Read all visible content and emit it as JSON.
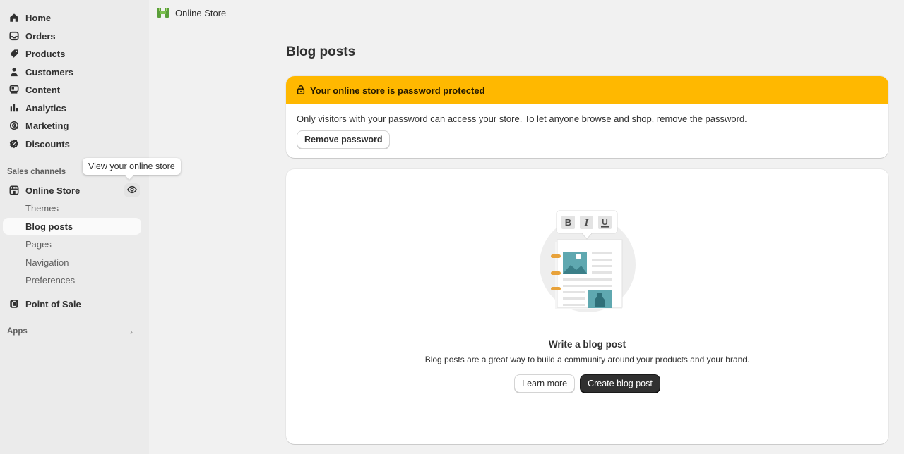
{
  "sidebar": {
    "items": [
      {
        "label": "Home",
        "icon": "home-icon"
      },
      {
        "label": "Orders",
        "icon": "inbox-icon"
      },
      {
        "label": "Products",
        "icon": "tag-icon"
      },
      {
        "label": "Customers",
        "icon": "person-icon"
      },
      {
        "label": "Content",
        "icon": "content-icon"
      },
      {
        "label": "Analytics",
        "icon": "bar-chart-icon"
      },
      {
        "label": "Marketing",
        "icon": "target-icon"
      },
      {
        "label": "Discounts",
        "icon": "discount-icon"
      }
    ],
    "sales_channels_label": "Sales channels",
    "online_store": {
      "label": "Online Store",
      "tooltip": "View your online store",
      "sub_items": [
        "Themes",
        "Blog posts",
        "Pages",
        "Navigation",
        "Preferences"
      ]
    },
    "point_of_sale": "Point of Sale",
    "apps_label": "Apps"
  },
  "topbar": {
    "title": "Online Store"
  },
  "main": {
    "page_title": "Blog posts",
    "banner": {
      "title": "Your online store is password protected",
      "body": "Only visitors with your password can access your store. To let anyone browse and shop, remove the password.",
      "button": "Remove password"
    },
    "empty_state": {
      "title": "Write a blog post",
      "description": "Blog posts are a great way to build a community around your products and your brand.",
      "secondary_button": "Learn more",
      "primary_button": "Create blog post"
    }
  },
  "colors": {
    "banner_bg": "#ffb800",
    "sidebar_bg": "#ebebeb",
    "primary_button": "#303030"
  }
}
